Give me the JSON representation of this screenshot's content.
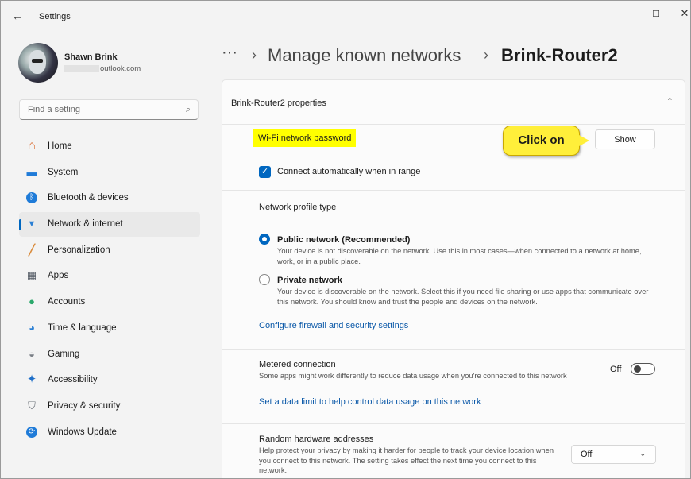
{
  "window": {
    "title": "Settings",
    "back_icon": "←",
    "minimize_icon": "–",
    "maximize_icon": "☐",
    "close_icon": "✕"
  },
  "profile": {
    "name": "Shawn Brink",
    "email_visible": "outlook.com"
  },
  "search": {
    "placeholder": "Find a setting",
    "icon": "⌕"
  },
  "sidebar": {
    "items": [
      {
        "label": "Home",
        "icon": "home-icon",
        "glyph": "⌂",
        "color": "#d9672b",
        "active": false
      },
      {
        "label": "System",
        "icon": "system-icon",
        "glyph": "▬",
        "color": "#1f7bd8",
        "active": false
      },
      {
        "label": "Bluetooth & devices",
        "icon": "bluetooth-icon",
        "glyph": "ᛒ",
        "color": "#1f7bd8",
        "active": false
      },
      {
        "label": "Network & internet",
        "icon": "wifi-icon",
        "glyph": "▼",
        "color": "#2a7fd4",
        "active": true
      },
      {
        "label": "Personalization",
        "icon": "brush-icon",
        "glyph": "╱",
        "color": "#d98a3a",
        "active": false
      },
      {
        "label": "Apps",
        "icon": "apps-icon",
        "glyph": "▦",
        "color": "#555c66",
        "active": false
      },
      {
        "label": "Accounts",
        "icon": "accounts-icon",
        "glyph": "●",
        "color": "#2aa86b",
        "active": false
      },
      {
        "label": "Time & language",
        "icon": "globe-clock-icon",
        "glyph": "◕",
        "color": "#2a7fd4",
        "active": false
      },
      {
        "label": "Gaming",
        "icon": "gamepad-icon",
        "glyph": "◒",
        "color": "#7a7f86",
        "active": false
      },
      {
        "label": "Accessibility",
        "icon": "accessibility-icon",
        "glyph": "✦",
        "color": "#1f6fc8",
        "active": false
      },
      {
        "label": "Privacy & security",
        "icon": "shield-icon",
        "glyph": "⛉",
        "color": "#6e747b",
        "active": false
      },
      {
        "label": "Windows Update",
        "icon": "update-icon",
        "glyph": "⟳",
        "color": "#1f7bd8",
        "active": false
      }
    ]
  },
  "breadcrumb": {
    "dots": "···",
    "separator": "›",
    "parent": "Manage known networks",
    "current": "Brink-Router2"
  },
  "panel": {
    "title": "Brink-Router2 properties",
    "collapse_icon": "⌃",
    "password_label": "Wi-Fi network password",
    "callout": "Click on",
    "show_button": "Show",
    "auto_connect_label": "Connect automatically when in range",
    "auto_connect_checked": true,
    "checkmark": "✓",
    "profile_type_label": "Network profile type",
    "public": {
      "title": "Public network (Recommended)",
      "description": "Your device is not discoverable on the network. Use this in most cases—when connected to a network at home, work, or in a public place.",
      "selected": true
    },
    "private": {
      "title": "Private network",
      "description": "Your device is discoverable on the network. Select this if you need file sharing or use apps that communicate over this network. You should know and trust the people and devices on the network.",
      "selected": false
    },
    "firewall_link": "Configure firewall and security settings",
    "metered": {
      "title": "Metered connection",
      "description": "Some apps might work differently to reduce data usage when you're connected to this network",
      "state": "Off",
      "on": false
    },
    "data_limit_link": "Set a data limit to help control data usage on this network",
    "random_hw": {
      "title": "Random hardware addresses",
      "description": "Help protect your privacy by making it harder for people to track your device location when you connect to this network. The setting takes effect the next time you connect to this network.",
      "value": "Off",
      "dropdown_icon": "⌄"
    }
  },
  "colors": {
    "accent": "#0067c0",
    "highlight": "#ffff00",
    "callout": "#ffef3a"
  }
}
